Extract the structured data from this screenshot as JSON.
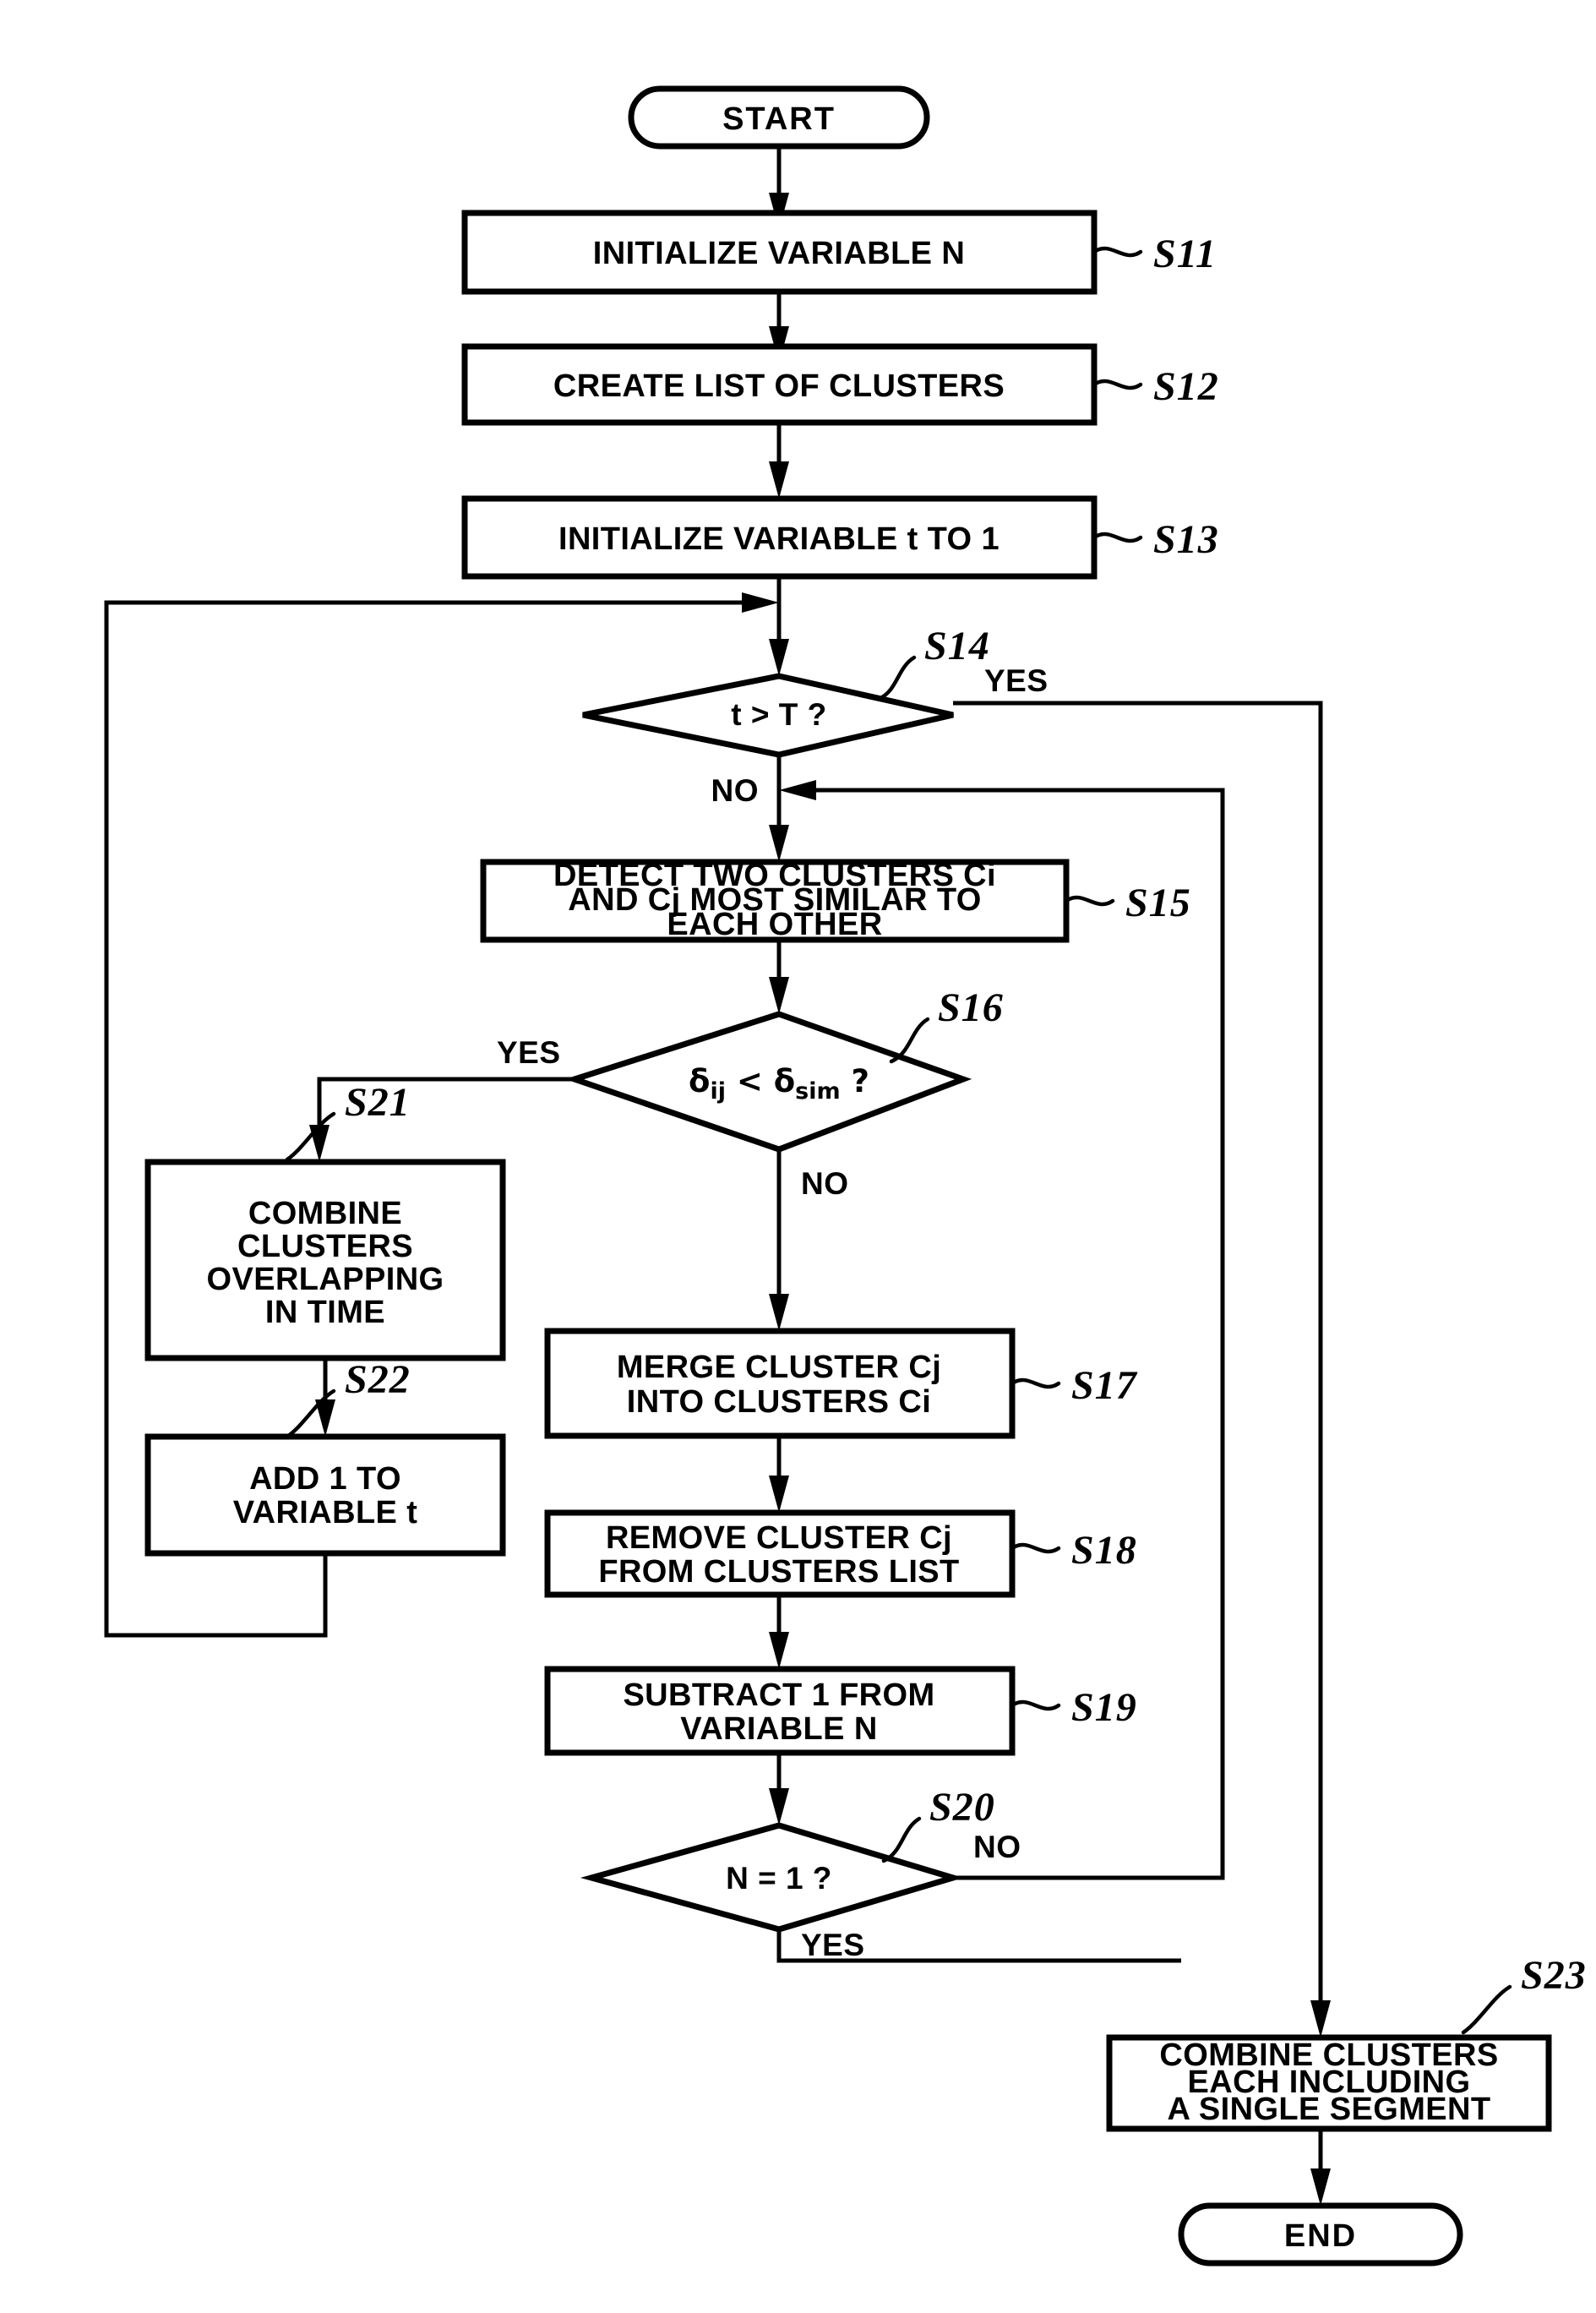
{
  "diagram": {
    "type": "flowchart",
    "title": "",
    "start_label": "START",
    "end_label": "END",
    "branch_labels": {
      "yes": "YES",
      "no": "NO"
    },
    "nodes": [
      {
        "id": "start",
        "shape": "terminator",
        "label": "START",
        "ref": ""
      },
      {
        "id": "s11",
        "shape": "process",
        "lines": [
          "INITIALIZE VARIABLE N"
        ],
        "ref": "S11"
      },
      {
        "id": "s12",
        "shape": "process",
        "lines": [
          "CREATE LIST OF CLUSTERS"
        ],
        "ref": "S12"
      },
      {
        "id": "s13",
        "shape": "process",
        "lines": [
          "INITIALIZE VARIABLE t TO 1"
        ],
        "ref": "S13"
      },
      {
        "id": "s14",
        "shape": "decision",
        "lines": [
          "t > T ?"
        ],
        "ref": "S14",
        "yes": "YES",
        "no": "NO"
      },
      {
        "id": "s15",
        "shape": "process",
        "lines": [
          "DETECT TWO CLUSTERS Ci",
          "AND Cj MOST SIMILAR TO",
          "EACH OTHER"
        ],
        "ref": "S15"
      },
      {
        "id": "s16",
        "shape": "decision",
        "lines": [
          "δij < δsim ?"
        ],
        "ref": "S16",
        "yes": "YES",
        "no": "NO"
      },
      {
        "id": "s21",
        "shape": "process",
        "lines": [
          "COMBINE",
          "CLUSTERS",
          "OVERLAPPING",
          "IN TIME"
        ],
        "ref": "S21"
      },
      {
        "id": "s22",
        "shape": "process",
        "lines": [
          "ADD 1 TO",
          "VARIABLE t"
        ],
        "ref": "S22"
      },
      {
        "id": "s17",
        "shape": "process",
        "lines": [
          "MERGE CLUSTER Cj",
          "INTO CLUSTERS Ci"
        ],
        "ref": "S17"
      },
      {
        "id": "s18",
        "shape": "process",
        "lines": [
          "REMOVE CLUSTER Cj",
          "FROM CLUSTERS LIST"
        ],
        "ref": "S18"
      },
      {
        "id": "s19",
        "shape": "process",
        "lines": [
          "SUBTRACT 1 FROM",
          "VARIABLE N"
        ],
        "ref": "S19"
      },
      {
        "id": "s20",
        "shape": "decision",
        "lines": [
          "N = 1 ?"
        ],
        "ref": "S20",
        "yes": "YES",
        "no": "NO"
      },
      {
        "id": "s23",
        "shape": "process",
        "lines": [
          "COMBINE CLUSTERS",
          "EACH INCLUDING",
          "A SINGLE SEGMENT"
        ],
        "ref": "S23"
      },
      {
        "id": "end",
        "shape": "terminator",
        "label": "END",
        "ref": ""
      }
    ],
    "edges": [
      {
        "from": "start",
        "to": "s11",
        "label": ""
      },
      {
        "from": "s11",
        "to": "s12",
        "label": ""
      },
      {
        "from": "s12",
        "to": "s13",
        "label": ""
      },
      {
        "from": "s13",
        "to": "s14",
        "label": ""
      },
      {
        "from": "s14",
        "to": "s23",
        "label": "YES"
      },
      {
        "from": "s14",
        "to": "s15",
        "label": "NO"
      },
      {
        "from": "s15",
        "to": "s16",
        "label": ""
      },
      {
        "from": "s16",
        "to": "s21",
        "label": "YES"
      },
      {
        "from": "s16",
        "to": "s17",
        "label": "NO"
      },
      {
        "from": "s21",
        "to": "s22",
        "label": ""
      },
      {
        "from": "s22",
        "to": "s14",
        "label": ""
      },
      {
        "from": "s17",
        "to": "s18",
        "label": ""
      },
      {
        "from": "s18",
        "to": "s19",
        "label": ""
      },
      {
        "from": "s19",
        "to": "s20",
        "label": ""
      },
      {
        "from": "s20",
        "to": "s15",
        "label": "NO"
      },
      {
        "from": "s20",
        "to": "s23",
        "label": "YES"
      },
      {
        "from": "s23",
        "to": "end",
        "label": ""
      }
    ]
  },
  "labels": {
    "start": "START",
    "end": "END",
    "s11": "INITIALIZE VARIABLE N",
    "s12": "CREATE LIST OF CLUSTERS",
    "s13": "INITIALIZE VARIABLE t TO 1",
    "s14_cond": "t > T ?",
    "s15_l1": "DETECT TWO CLUSTERS Ci",
    "s15_l2": "AND Cj MOST SIMILAR TO",
    "s15_l3": "EACH OTHER",
    "s21_l1": "COMBINE",
    "s21_l2": "CLUSTERS",
    "s21_l3": "OVERLAPPING",
    "s21_l4": "IN TIME",
    "s22_l1": "ADD 1 TO",
    "s22_l2": "VARIABLE t",
    "s17_l1": "MERGE CLUSTER Cj",
    "s17_l2": "INTO CLUSTERS Ci",
    "s18_l1": "REMOVE CLUSTER Cj",
    "s18_l2": "FROM CLUSTERS LIST",
    "s19_l1": "SUBTRACT 1 FROM",
    "s19_l2": "VARIABLE N",
    "s20_cond": "N = 1 ?",
    "s23_l1": "COMBINE CLUSTERS",
    "s23_l2": "EACH INCLUDING",
    "s23_l3": "A SINGLE SEGMENT"
  },
  "refs": {
    "s11": "S11",
    "s12": "S12",
    "s13": "S13",
    "s14": "S14",
    "s15": "S15",
    "s16": "S16",
    "s17": "S17",
    "s18": "S18",
    "s19": "S19",
    "s20": "S20",
    "s21": "S21",
    "s22": "S22",
    "s23": "S23"
  },
  "branches": {
    "s14_yes": "YES",
    "s14_no": "NO",
    "s16_yes": "YES",
    "s16_no": "NO",
    "s20_yes": "YES",
    "s20_no": "NO"
  },
  "colors": {
    "stroke": "#000000",
    "fill": "#ffffff",
    "background": "#ffffff"
  }
}
